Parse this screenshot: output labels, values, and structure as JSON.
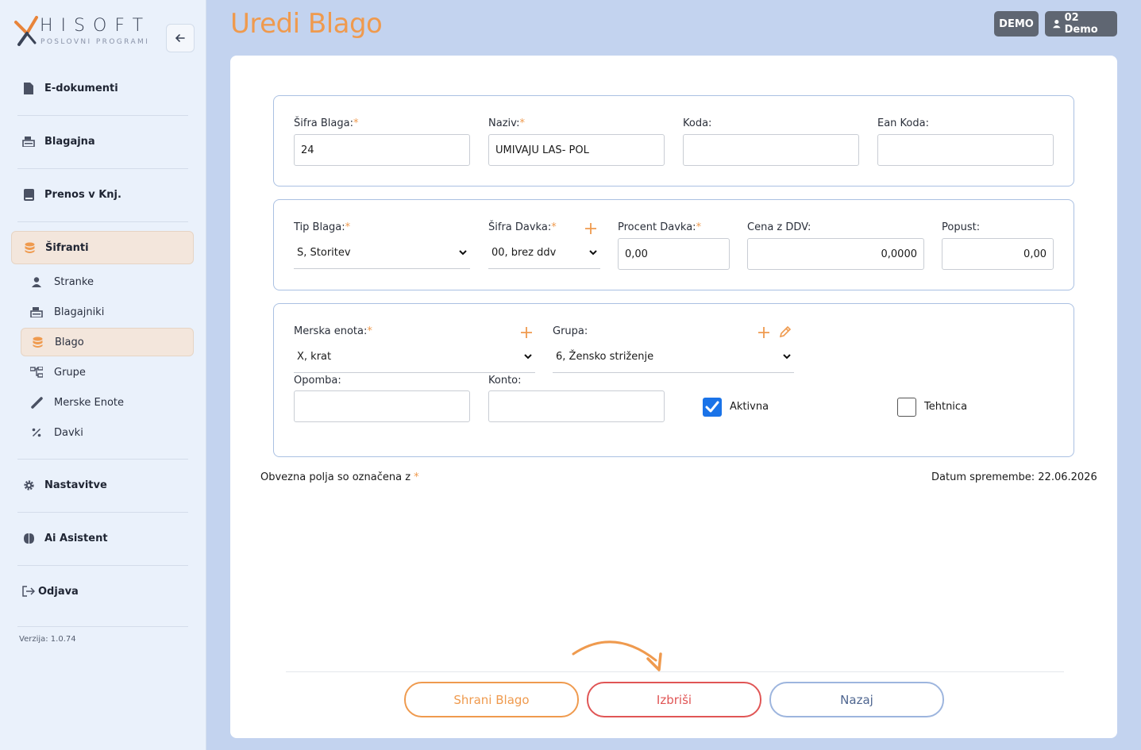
{
  "sidebar": {
    "logo_text": "HISOFT",
    "logo_sub": "POSLOVNI PROGRAMI",
    "main_items": [
      {
        "label": "E-dokumenti",
        "icon": "file-icon"
      },
      {
        "label": "Blagajna",
        "icon": "cash-register-icon"
      },
      {
        "label": "Prenos v Knj.",
        "icon": "book-icon"
      },
      {
        "label": "Šifranti",
        "icon": "database-icon"
      }
    ],
    "sub_items": [
      {
        "label": "Stranke",
        "icon": "user-icon"
      },
      {
        "label": "Blagajniki",
        "icon": "cash-register-icon"
      },
      {
        "label": "Blago",
        "icon": "database-icon"
      },
      {
        "label": "Grupe",
        "icon": "sitemap-icon"
      },
      {
        "label": "Merske Enote",
        "icon": "ruler-icon"
      },
      {
        "label": "Davki",
        "icon": "percent-icon"
      }
    ],
    "bottom_items": [
      {
        "label": "Nastavitve",
        "icon": "gear-icon"
      },
      {
        "label": "Ai Asistent",
        "icon": "brain-icon"
      },
      {
        "label": "Odjava",
        "icon": "logout-icon"
      }
    ],
    "version": "Verzija: 1.0.74"
  },
  "header": {
    "title": "Uredi Blago",
    "badge_demo": "DEMO",
    "badge_user": "02 Demo"
  },
  "form": {
    "sifra_label": "Šifra Blaga:",
    "sifra_value": "24",
    "naziv_label": "Naziv:",
    "naziv_value": "UMIVAJU LAS- POL",
    "koda_label": "Koda:",
    "koda_value": "",
    "ean_label": "Ean Koda:",
    "ean_value": "",
    "tip_label": "Tip Blaga:",
    "tip_value": "S, Storitev",
    "sifra_davka_label": "Šifra Davka:",
    "sifra_davka_value": "00, brez ddv",
    "procent_label": "Procent Davka:",
    "procent_value": "0,00",
    "cena_label": "Cena z DDV:",
    "cena_value": "0,0000",
    "popust_label": "Popust:",
    "popust_value": "0,00",
    "merska_label": "Merska enota:",
    "merska_value": "X, krat",
    "grupa_label": "Grupa:",
    "grupa_value": "6, Žensko striženje",
    "opomba_label": "Opomba:",
    "opomba_value": "",
    "konto_label": "Konto:",
    "konto_value": "",
    "aktivna_label": "Aktivna",
    "aktivna_checked": true,
    "tehtnica_label": "Tehtnica",
    "tehtnica_checked": false,
    "required_mark": "*"
  },
  "footer": {
    "required_note": "Obvezna polja so označena z",
    "date_label": "Datum spremembe: 22.06.2026",
    "save": "Shrani Blago",
    "delete": "Izbriši",
    "back": "Nazaj"
  },
  "colors": {
    "accent": "#ef9a4e",
    "danger": "#e05555",
    "checkbox": "#1a73e8",
    "background": "#c3d3ef"
  }
}
